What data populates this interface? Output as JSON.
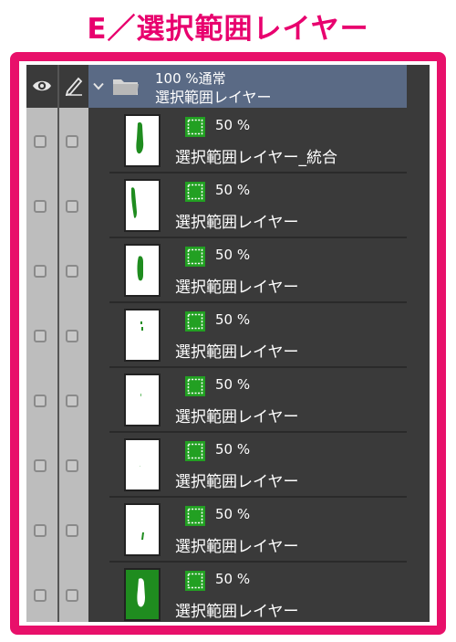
{
  "colors": {
    "title": "#e8006e",
    "frame": "#e8106a",
    "panel_bg": "#3a3a3a",
    "folder_header_bg": "#5a6a85",
    "mask_green": "#22a022",
    "thumb_green": "#1f8c1f"
  },
  "title": "E／選択範囲レイヤー",
  "header": {
    "eye_icon": "eye-icon",
    "pen_icon": "pen-icon",
    "chevron_icon": "chevron-down-icon",
    "folder_icon": "folder-icon",
    "opacity_blend": "100 %通常",
    "name": "選択範囲レイヤー"
  },
  "layers": [
    {
      "opacity": "50 %",
      "name": "選択範囲レイヤー_統合"
    },
    {
      "opacity": "50 %",
      "name": "選択範囲レイヤー"
    },
    {
      "opacity": "50 %",
      "name": "選択範囲レイヤー"
    },
    {
      "opacity": "50 %",
      "name": "選択範囲レイヤー"
    },
    {
      "opacity": "50 %",
      "name": "選択範囲レイヤー"
    },
    {
      "opacity": "50 %",
      "name": "選択範囲レイヤー"
    },
    {
      "opacity": "50 %",
      "name": "選択範囲レイヤー"
    },
    {
      "opacity": "50 %",
      "name": "選択範囲レイヤー"
    }
  ]
}
